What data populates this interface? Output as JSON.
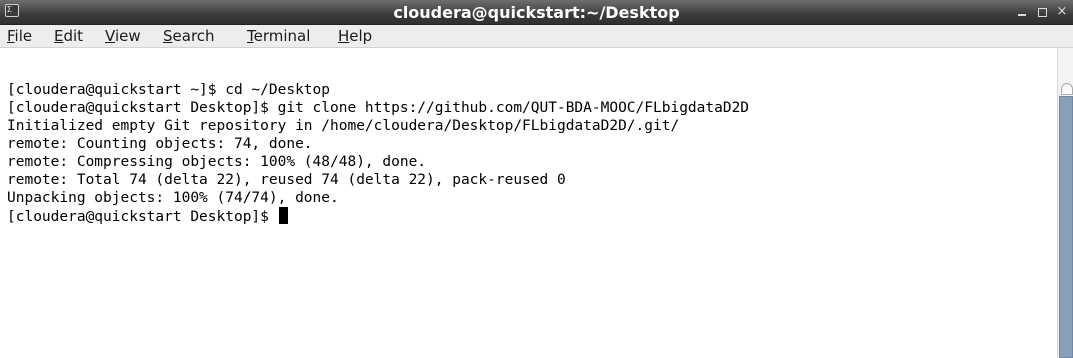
{
  "window": {
    "title": "cloudera@quickstart:~/Desktop",
    "icon": "terminal-icon",
    "icon_glyph": "Σ",
    "controls": {
      "minimize": "minimize-icon",
      "maximize": "maximize-icon",
      "close": "close-icon",
      "close_glyph": "×"
    }
  },
  "menubar": {
    "items": [
      {
        "mnemonic": "F",
        "rest": "ile"
      },
      {
        "mnemonic": "E",
        "rest": "dit"
      },
      {
        "mnemonic": "V",
        "rest": "iew"
      },
      {
        "mnemonic": "S",
        "rest": "earch"
      },
      {
        "mnemonic": "T",
        "rest": "erminal"
      },
      {
        "mnemonic": "H",
        "rest": "elp"
      }
    ]
  },
  "terminal": {
    "lines": [
      "[cloudera@quickstart ~]$ cd ~/Desktop",
      "[cloudera@quickstart Desktop]$ git clone https://github.com/QUT-BDA-MOOC/FLbigdataD2D",
      "Initialized empty Git repository in /home/cloudera/Desktop/FLbigdataD2D/.git/",
      "remote: Counting objects: 74, done.",
      "remote: Compressing objects: 100% (48/48), done.",
      "remote: Total 74 (delta 22), reused 74 (delta 22), pack-reused 0",
      "Unpacking objects: 100% (74/74), done.",
      "[cloudera@quickstart Desktop]$ "
    ]
  }
}
